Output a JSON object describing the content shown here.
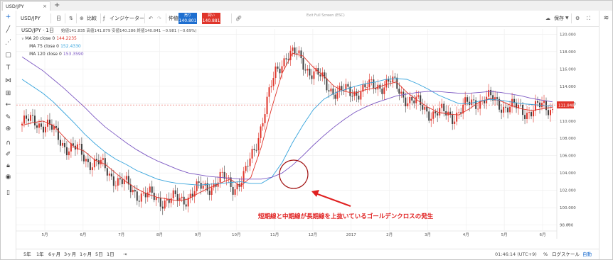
{
  "tabs": [
    {
      "label": "USD/JPY",
      "close": "×"
    }
  ],
  "tab_add": "+",
  "toolbar": {
    "symbol": "USD/JPY",
    "interval": "日",
    "compare": "比較",
    "indicators": "インジケーター",
    "price_label": "仲値",
    "bid": {
      "label": "売り",
      "value": "140.801",
      "color": "#1e6fd0"
    },
    "ask": {
      "label": "買い",
      "value": "140.881",
      "color": "#e0352b"
    },
    "exit_fullscreen": "Exit Full Screen (ESC)",
    "save": "保存"
  },
  "legend": {
    "title": "USD/JPY · 1日",
    "ohlc": "始値141.835  高値141.879  安値140.286  終値140.841  −0.981 (−0.69%)",
    "ma": [
      {
        "label": "MA 20 close 0",
        "value": "144.2235",
        "color": "#e0352b"
      },
      {
        "label": "MA 75 close 0",
        "value": "152.4330",
        "color": "#35a3dc"
      },
      {
        "label": "MA 120 close 0",
        "value": "153.3590",
        "color": "#7b57c2"
      }
    ]
  },
  "bottom": {
    "ranges": [
      "5年",
      "1年",
      "6ヶ月",
      "3ヶ月",
      "1ヶ月",
      "5日",
      "1日"
    ],
    "clock": "01:46:14 (UTC+9)",
    "percent": "%",
    "log": "ログスケール",
    "auto": "自動"
  },
  "annotation": "短期線と中期線が長期線を上抜いているゴールデンクロスの発生",
  "colors": {
    "up": "#e0352b",
    "down": "#404040",
    "ma20": "#e0352b",
    "ma75": "#35a3dc",
    "ma120": "#7b57c2",
    "grid": "#eeeeee"
  },
  "chart_data": {
    "type": "line",
    "title": "USD/JPY · 1日",
    "x_ticks": [
      "5月",
      "6月",
      "7月",
      "8月",
      "9月",
      "10月",
      "11月",
      "12月",
      "2017",
      "2月",
      "3月",
      "4月",
      "5月",
      "6月"
    ],
    "y_ticks": [
      98,
      100,
      102,
      104,
      106,
      108,
      110,
      112,
      114,
      116,
      118,
      120
    ],
    "ylim": [
      97.4,
      120.6
    ],
    "last_price_label": "111.848",
    "series": [
      {
        "name": "MA 20 close 0",
        "color": "#e0352b",
        "values": [
          109.5,
          109.8,
          110.0,
          109.5,
          108.2,
          107.0,
          106.5,
          105.5,
          105.0,
          104.0,
          103.0,
          102.2,
          101.6,
          101.2,
          101.0,
          100.8,
          101.0,
          101.7,
          102.3,
          102.8,
          103.3,
          102.5,
          103.5,
          107.0,
          111.5,
          115.5,
          117.8,
          117.5,
          116.2,
          115.2,
          114.0,
          113.4,
          113.2,
          113.6,
          113.8,
          114.2,
          114.5,
          113.3,
          112.4,
          111.6,
          111.0,
          110.8,
          110.7,
          111.4,
          112.2,
          112.6,
          112.3,
          111.8,
          111.4,
          111.2,
          111.4,
          111.6
        ]
      },
      {
        "name": "MA 75 close 0",
        "color": "#35a3dc",
        "values": [
          114.8,
          114.0,
          113.2,
          112.2,
          111.0,
          109.8,
          108.5,
          107.4,
          106.4,
          105.6,
          105.0,
          104.3,
          103.8,
          103.3,
          103.0,
          102.8,
          102.7,
          102.6,
          102.7,
          102.8,
          102.9,
          103.0,
          102.8,
          102.8,
          103.5,
          105.2,
          107.5,
          109.5,
          111.3,
          112.5,
          113.2,
          113.6,
          114.0,
          114.3,
          114.5,
          114.8,
          114.9,
          114.8,
          114.3,
          113.7,
          113.0,
          112.5,
          112.0,
          112.0,
          112.3,
          112.5,
          112.4,
          112.2,
          112.0,
          111.9,
          111.8,
          111.7
        ]
      },
      {
        "name": "MA 120 close 0",
        "color": "#7b57c2",
        "values": [
          117.4,
          116.6,
          115.8,
          114.8,
          113.8,
          112.7,
          111.6,
          110.4,
          109.3,
          108.4,
          107.5,
          106.7,
          106.0,
          105.4,
          104.9,
          104.4,
          104.0,
          103.8,
          103.6,
          103.5,
          103.4,
          103.3,
          103.3,
          103.3,
          103.5,
          104.0,
          104.9,
          106.0,
          107.2,
          108.3,
          109.3,
          110.2,
          111.0,
          111.6,
          112.1,
          112.5,
          112.9,
          113.1,
          113.3,
          113.4,
          113.4,
          113.3,
          113.2,
          113.2,
          113.3,
          113.4,
          113.3,
          113.1,
          112.9,
          112.6,
          112.4,
          112.2
        ]
      }
    ]
  }
}
